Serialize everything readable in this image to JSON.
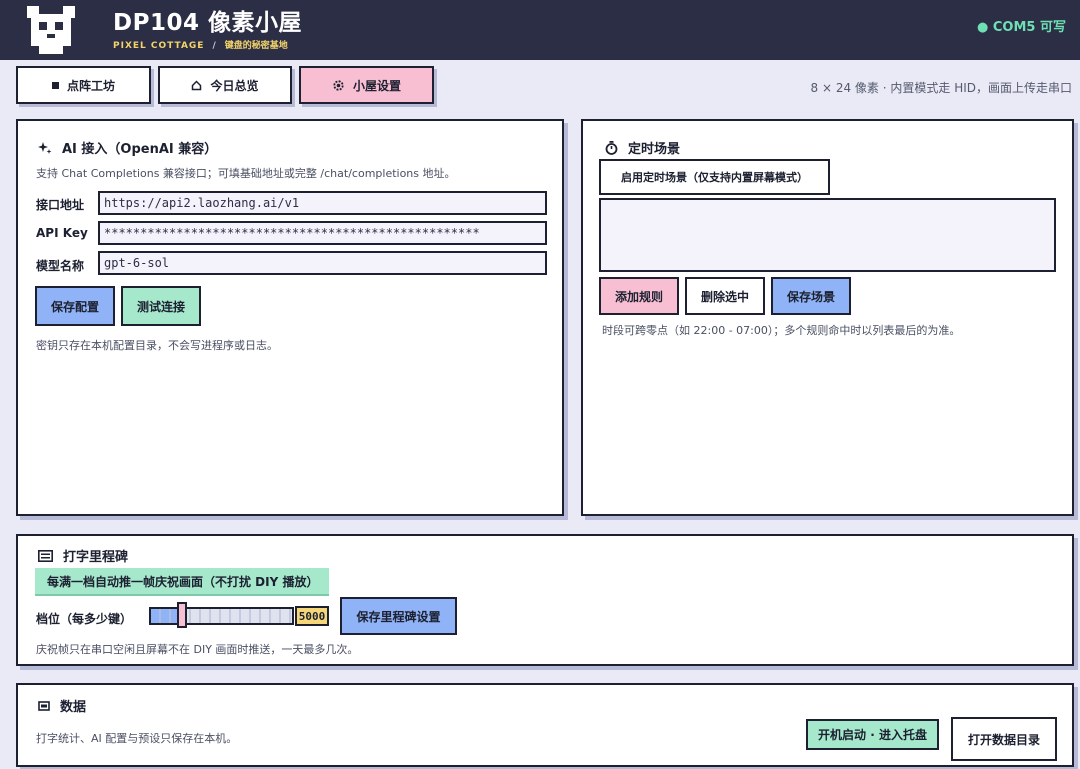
{
  "header": {
    "title": "DP104  像素小屋",
    "subtitle": "PIXEL COTTAGE",
    "separator": "/",
    "tagline": "键盘的秘密基地",
    "com_status": "● COM5 可写"
  },
  "nav": {
    "tabs": [
      {
        "label": "点阵工坊",
        "icon": "square-icon",
        "active": false
      },
      {
        "label": "今日总览",
        "icon": "home-icon",
        "active": false
      },
      {
        "label": "小屋设置",
        "icon": "gear-icon",
        "active": true
      }
    ],
    "hint": "8 × 24 像素 · 内置模式走 HID，画面上传走串口"
  },
  "ai_panel": {
    "title": "AI 接入（OpenAI 兼容）",
    "icon": "sparkle-icon",
    "description": "支持 Chat Completions 兼容接口；可填基础地址或完整 /chat/completions 地址。",
    "fields": [
      {
        "label": "接口地址",
        "value": "https://api2.laozhang.ai/v1"
      },
      {
        "label": "API Key",
        "value": "****************************************************"
      },
      {
        "label": "模型名称",
        "value": "gpt-6-sol"
      }
    ],
    "save_label": "保存配置",
    "test_label": "测试连接",
    "note": "密钥只存在本机配置目录，不会写进程序或日志。"
  },
  "schedule_panel": {
    "title": "定时场景",
    "icon": "timer-icon",
    "enable_label": "启用定时场景（仅支持内置屏幕模式）",
    "add_label": "添加规则",
    "delete_label": "删除选中",
    "save_label": "保存场景",
    "note": "时段可跨零点（如 22:00 - 07:00）；多个规则命中时以列表最后的为准。"
  },
  "milestone_panel": {
    "title": "打字里程碑",
    "icon": "keyboard-icon",
    "banner": "每满一档自动推一帧庆祝画面（不打扰 DIY 播放）",
    "step_label": "档位（每多少键）",
    "step_value": "5000",
    "step_level": 0.22,
    "save_label": "保存里程碑设置",
    "note": "庆祝帧只在串口空闲且屏幕不在 DIY 画面时推送，一天最多几次。"
  },
  "data_panel": {
    "title": "数据",
    "icon": "database-icon",
    "note": "打字统计、AI 配置与预设只保存在本机。",
    "startup_label": "开机启动 · 进入托盘",
    "open_dir_label": "打开数据目录"
  },
  "colors": {
    "header_bg": "#2b2e44",
    "page_bg": "#e9eaf6",
    "accent_pink": "#f8bfd2",
    "accent_blue": "#8fb3f6",
    "accent_green": "#a6e8cc",
    "accent_yellow": "#f5d77a",
    "status_green": "#6ee0b4"
  }
}
